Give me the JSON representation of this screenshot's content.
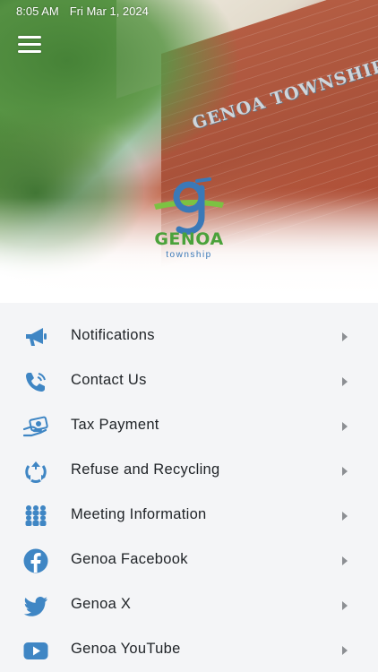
{
  "status_bar": {
    "time": "8:05 AM",
    "date": "Fri Mar 1, 2024"
  },
  "header": {
    "building_sign": "GENOA TOWNSHIP HALL",
    "logo": {
      "word": "GENOA",
      "sub": "township"
    }
  },
  "colors": {
    "icon": "#3f86c4",
    "logo_green": "#4aa23a",
    "logo_blue": "#3a79b8"
  },
  "menu": {
    "items": [
      {
        "label": "Notifications",
        "icon": "megaphone-icon"
      },
      {
        "label": "Contact Us",
        "icon": "phone-icon"
      },
      {
        "label": "Tax Payment",
        "icon": "payment-icon"
      },
      {
        "label": "Refuse and Recycling",
        "icon": "recycle-icon"
      },
      {
        "label": "Meeting Information",
        "icon": "people-icon"
      },
      {
        "label": "Genoa Facebook",
        "icon": "facebook-icon"
      },
      {
        "label": "Genoa X",
        "icon": "twitter-icon"
      },
      {
        "label": "Genoa YouTube",
        "icon": "youtube-icon"
      }
    ]
  }
}
